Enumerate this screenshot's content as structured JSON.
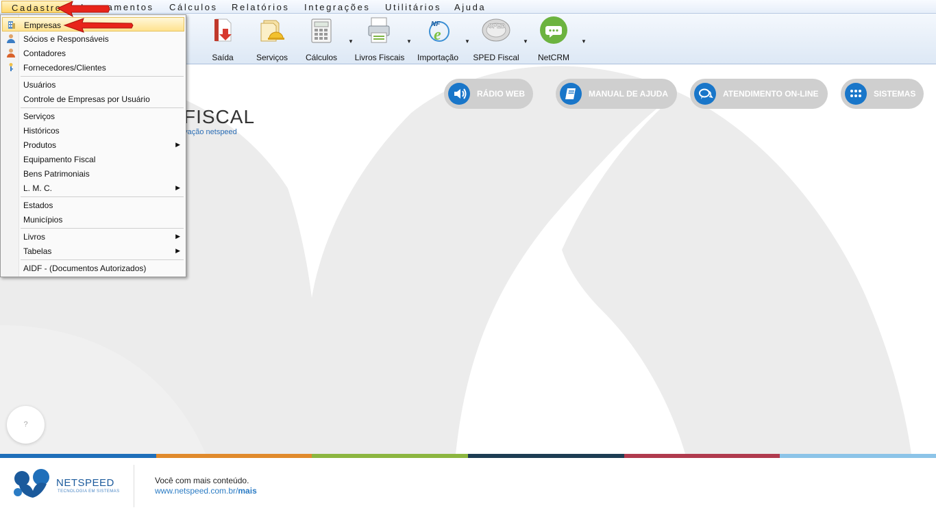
{
  "menubar": {
    "items": [
      "Cadastros",
      "Lançamentos",
      "Cálculos",
      "Relatórios",
      "Integrações",
      "Utilitários",
      "Ajuda"
    ]
  },
  "toolbar": {
    "items": [
      {
        "label": "Saída",
        "icon": "document-red-arrow-icon"
      },
      {
        "label": "Serviços",
        "icon": "documents-helmet-icon"
      },
      {
        "label": "Cálculos",
        "icon": "calculator-icon"
      },
      {
        "label": "Livros Fiscais",
        "icon": "printer-book-icon"
      },
      {
        "label": "Importação",
        "icon": "nfe-icon"
      },
      {
        "label": "SPED Fiscal",
        "icon": "sped-disc-icon"
      },
      {
        "label": "NetCRM",
        "icon": "chat-bubble-icon"
      }
    ]
  },
  "main": {
    "logo_text": "FISCAL",
    "logo_subtitle": "ovação netspeed",
    "pills": [
      {
        "label": "RÁDIO WEB",
        "icon": "speaker-icon"
      },
      {
        "label": "MANUAL DE AJUDA",
        "icon": "book-icon"
      },
      {
        "label": "ATENDIMENTO ON-LINE",
        "icon": "chat-icon"
      },
      {
        "label": "SISTEMAS",
        "icon": "grid-dots-icon"
      }
    ],
    "help_bubble": "?"
  },
  "colors": {
    "strip": [
      "#1f6fba",
      "#e08a2c",
      "#8cb640",
      "#1d3d53",
      "#b03a4e",
      "#8cc4e8"
    ],
    "accent": "#1976c9"
  },
  "footer": {
    "brand_name": "NETSPEED",
    "brand_tagline": "TECNOLOGIA EM SISTEMAS",
    "slogan": "Você com mais conteúdo.",
    "link_prefix": "www.netspeed.com.br/",
    "link_bold": "mais"
  },
  "dropdown": {
    "groups": [
      [
        "Empresas",
        "Sócios e Responsáveis",
        "Contadores",
        "Fornecedores/Clientes"
      ],
      [
        "Usuários",
        "Controle de Empresas por Usuário"
      ],
      [
        "Serviços",
        "Históricos",
        "Produtos",
        "Equipamento Fiscal",
        "Bens Patrimoniais",
        "L. M. C."
      ],
      [
        "Estados",
        "Municípios"
      ],
      [
        "Livros",
        "Tabelas"
      ],
      [
        "AIDF - (Documentos Autorizados)"
      ]
    ],
    "submenu_arrow": "▶"
  }
}
